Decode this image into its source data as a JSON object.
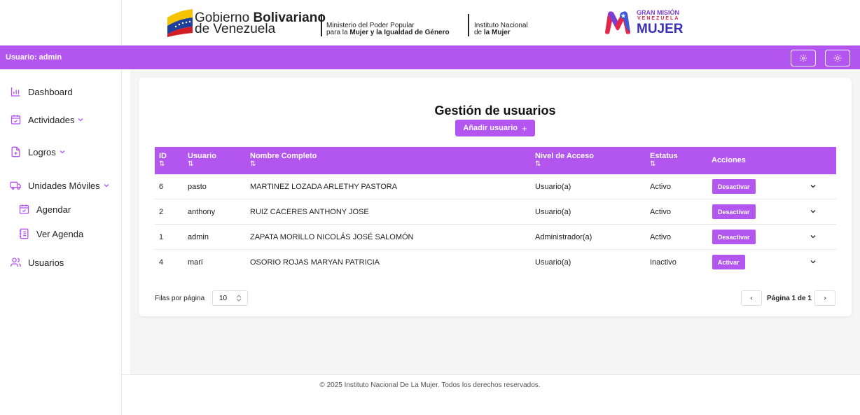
{
  "header": {
    "gob_line1_light": "Gobierno",
    "gob_line1_bold": "Bolivariano",
    "gob_line2": "de Venezuela",
    "ministerio_line1": "Ministerio del Poder Popular",
    "ministerio_line2_prefix": "para la",
    "ministerio_line2_bold": "Mujer y la Igualdad de Género",
    "instituto_line1": "Instituto Nacional",
    "instituto_line2_prefix": "de",
    "instituto_line2_bold": "la Mujer",
    "mision_line1": "GRAN MISIÓN",
    "mision_line2": "VENEZUELA",
    "mision_line3": "MUJER"
  },
  "userbar": {
    "user_text": "Usuario: admin",
    "accent": "#b356f0"
  },
  "sidebar": {
    "items": [
      {
        "label": "Dashboard",
        "icon": "chart-icon"
      },
      {
        "label": "Actividades",
        "icon": "calendar-icon"
      },
      {
        "label": "Logros",
        "icon": "file-plus-icon"
      },
      {
        "label": "Unidades Móviles",
        "icon": "truck-icon"
      },
      {
        "label": "Agendar",
        "icon": "calendar-check-icon"
      },
      {
        "label": "Ver Agenda",
        "icon": "notebook-icon"
      },
      {
        "label": "Usuarios",
        "icon": "users-icon"
      }
    ]
  },
  "main": {
    "title": "Gestión de usuarios",
    "add_button": "Añadir usuario",
    "add_symbol": "+",
    "columns": [
      "ID",
      "Usuario",
      "Nombre Completo",
      "Nivel de Acceso",
      "Estatus",
      "Acciones"
    ],
    "sort_symbol": "⇅",
    "rows": [
      {
        "id": "6",
        "usuario": "pasto",
        "nombre": "MARTINEZ LOZADA ARLETHY PASTORA",
        "nivel": "Usuario(a)",
        "estatus": "Activo",
        "accion": "Desactivar"
      },
      {
        "id": "2",
        "usuario": "anthony",
        "nombre": "RUIZ CACERES ANTHONY JOSE",
        "nivel": "Usuario(a)",
        "estatus": "Activo",
        "accion": "Desactivar"
      },
      {
        "id": "1",
        "usuario": "admin",
        "nombre": "ZAPATA MORILLO NICOLÁS JOSÉ SALOMÓN",
        "nivel": "Administrador(a)",
        "estatus": "Activo",
        "accion": "Desactivar"
      },
      {
        "id": "4",
        "usuario": "mari",
        "nombre": "OSORIO ROJAS MARYAN PATRICIA",
        "nivel": "Usuario(a)",
        "estatus": "Inactivo",
        "accion": "Activar"
      }
    ],
    "rows_per_page_label": "Filas por página",
    "rows_per_page_value": "10",
    "page_text": "Página 1 de 1"
  },
  "footer": {
    "text": "© 2025 Instituto Nacional De La Mujer. Todos los derechos reservados."
  }
}
